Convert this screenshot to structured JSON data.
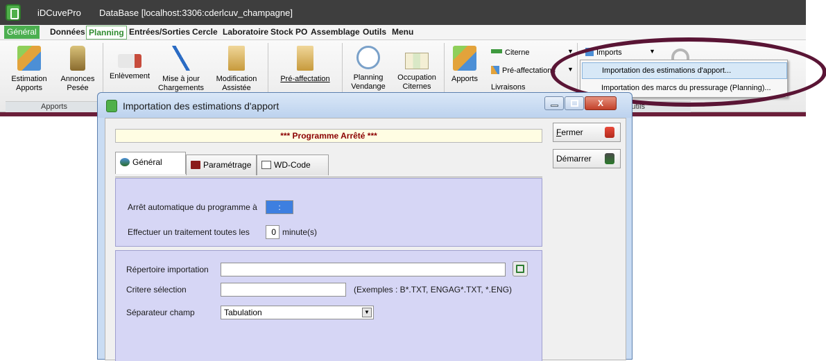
{
  "app": {
    "name": "iDCuvePro",
    "db_title": "DataBase [localhost:3306:cderlcuv_champagne]"
  },
  "menu": [
    "Général",
    "Données",
    "Planning",
    "Entrées/Sorties",
    "Cercle",
    "Laboratoire",
    "Stock PO",
    "Assemblage",
    "Outils",
    "Menu"
  ],
  "ribbon": {
    "btn_estimation": "Estimation\nApports",
    "btn_annonces": "Annonces\nPesée",
    "btn_enlevement": "Enlèvement",
    "btn_mise_a_jour": "Mise à jour\nChargements",
    "btn_modification": "Modification\nAssistée",
    "btn_pre_affectation": "Pré-affectation",
    "btn_planning": "Planning\nVendange",
    "btn_occupation": "Occupation\nCiternes",
    "btn_apports": "Apports",
    "citerne": "Citerne",
    "pre_affectations": "Pré-affectations",
    "livraisons": "Livraisons",
    "imports": "Imports",
    "group_apports": "Apports",
    "group_outils": "Outils"
  },
  "dropdown": {
    "item1": "Importation des estimations d'apport...",
    "item2": "Importation des marcs du pressurage (Planning)..."
  },
  "dialog": {
    "title": "Importation des estimations d'apport",
    "close_glyph": "X",
    "status": "*** Programme Arrêté ***",
    "fermer_first": "F",
    "fermer_rest": "ermer",
    "demarrer": "Démarrer",
    "tabs": [
      "Général",
      "Paramétrage",
      "WD-Code"
    ],
    "arret_label": "Arrêt automatique du programme à",
    "arret_value": ":",
    "traitement_label": "Effectuer un traitement toutes les",
    "traitement_value": "0",
    "traitement_unit": "minute(s)",
    "repertoire_label": "Répertoire importation",
    "repertoire_value": "",
    "critere_label": "Critere sélection",
    "critere_value": "",
    "exemples": "(Exemples : B*.TXT, ENGAG*.TXT, *.ENG)",
    "separateur_label": "Séparateur champ",
    "separateur_value": "Tabulation"
  },
  "colors": {
    "accent_green": "#4caf50",
    "maroon": "#6b1f3a",
    "panel_lavender": "#d6d6f5",
    "status_red": "#8b0000"
  }
}
